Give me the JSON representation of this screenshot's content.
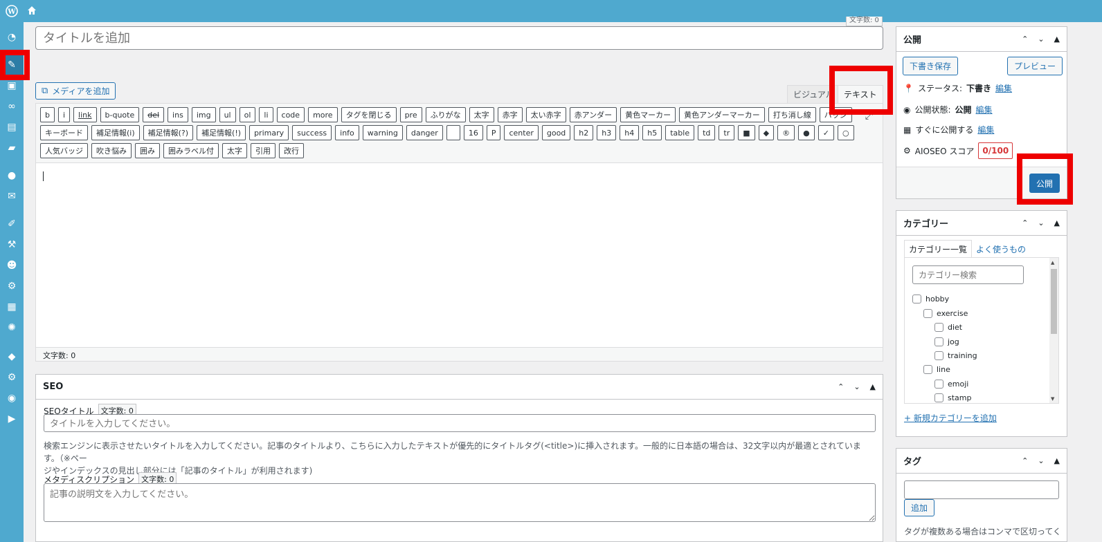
{
  "top": {
    "charcount": "文字数: 0"
  },
  "title_placeholder": "タイトルを追加",
  "media_button": "メディアを追加",
  "tabs": {
    "visual": "ビジュアル",
    "text": "テキスト"
  },
  "quicktags": {
    "row1": [
      "b",
      "i",
      "link",
      "b-quote",
      "del",
      "ins",
      "img",
      "ul",
      "ol",
      "li",
      "code",
      "more",
      "タグを閉じる",
      "pre",
      "ふりがな",
      "太字",
      "赤字",
      "太い赤字",
      "赤アンダー",
      "黄色マーカー",
      "黄色アンダーマーカー",
      "打ち消し線",
      "バッジ"
    ],
    "row2": [
      "キーボード",
      "補足情報(i)",
      "補足情報(?)",
      "補足情報(!)",
      "primary",
      "success",
      "info",
      "warning",
      "danger",
      "",
      "16",
      "P",
      "center",
      "good",
      "h2",
      "h3",
      "h4",
      "h5",
      "table",
      "td",
      "tr",
      "■",
      "◆",
      "®",
      "●",
      "✓",
      "○"
    ],
    "row3": [
      "人気バッジ",
      "吹き悩み",
      "囲み",
      "囲みラベル付",
      "太字",
      "引用",
      "改行"
    ]
  },
  "editor_status": "文字数: 0",
  "seo": {
    "title": "SEO",
    "seo_title_label": "SEOタイトル",
    "seo_title_count": "文字数: 0",
    "seo_title_placeholder": "タイトルを入力してください。",
    "help_line1": "検索エンジンに表示させたいタイトルを入力してください。記事のタイトルより、こちらに入力したテキストが優先的にタイトルタグ(<title>)に挿入されます。一般的に日本語の場合は、32文字以内が最適とされています。（※ペー",
    "help_line2": "ジやインデックスの見出し部分には「記事のタイトル」が利用されます)",
    "meta_label": "メタディスクリプション",
    "meta_count": "文字数: 0",
    "meta_placeholder": "記事の説明文を入力してください。"
  },
  "publish": {
    "title": "公開",
    "save_draft": "下書き保存",
    "preview": "プレビュー",
    "status_label": "ステータス:",
    "status_value": "下書き",
    "visibility_label": "公開状態:",
    "visibility_value": "公開",
    "schedule_label": "すぐに公開する",
    "edit": "編集",
    "aioseo_label": "AIOSEO スコア",
    "aioseo_score": "0/100",
    "publish_button": "公開"
  },
  "category": {
    "title": "カテゴリー",
    "tab_all": "カテゴリー一覧",
    "tab_popular": "よく使うもの",
    "search_placeholder": "カテゴリー検索",
    "items": [
      {
        "label": "hobby",
        "level": 0
      },
      {
        "label": "exercise",
        "level": 1
      },
      {
        "label": "diet",
        "level": 2
      },
      {
        "label": "jog",
        "level": 2
      },
      {
        "label": "training",
        "level": 2
      },
      {
        "label": "line",
        "level": 1
      },
      {
        "label": "emoji",
        "level": 2
      },
      {
        "label": "stamp",
        "level": 2
      }
    ],
    "add_new": "+ 新規カテゴリーを追加"
  },
  "tags": {
    "title": "タグ",
    "add_button": "追加",
    "help": "タグが複数ある場合はコンマで区切ってく"
  },
  "colors": {
    "admin_bar": "#4fa9cf",
    "primary": "#2271b1",
    "highlight": "#ee0000"
  }
}
